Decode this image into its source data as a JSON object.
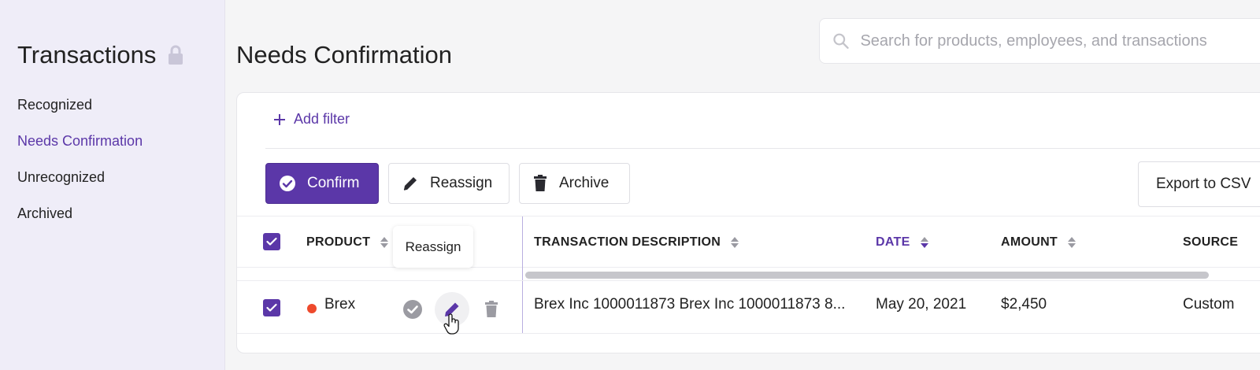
{
  "sidebar": {
    "title": "Transactions",
    "items": [
      {
        "label": "Recognized"
      },
      {
        "label": "Needs Confirmation",
        "active": true
      },
      {
        "label": "Unrecognized"
      },
      {
        "label": "Archived"
      }
    ]
  },
  "header": {
    "page_title": "Needs Confirmation",
    "search_placeholder": "Search for products, employees, and transactions"
  },
  "filters": {
    "add_filter_label": "Add filter"
  },
  "toolbar": {
    "confirm_label": "Confirm",
    "reassign_label": "Reassign",
    "archive_label": "Archive",
    "export_label": "Export to CSV"
  },
  "table": {
    "columns": [
      "PRODUCT",
      "TRANSACTION DESCRIPTION",
      "DATE",
      "AMOUNT",
      "SOURCE"
    ],
    "sorted_column": "DATE",
    "rows": [
      {
        "product": "Brex",
        "description": "Brex Inc 1000011873 Brex Inc 1000011873 8...",
        "date": "May 20, 2021",
        "amount": "$2,450",
        "source": "Custom"
      }
    ]
  },
  "tooltip": {
    "text": "Reassign"
  },
  "colors": {
    "accent": "#5b37a8",
    "status_dot": "#ee4a2c"
  }
}
